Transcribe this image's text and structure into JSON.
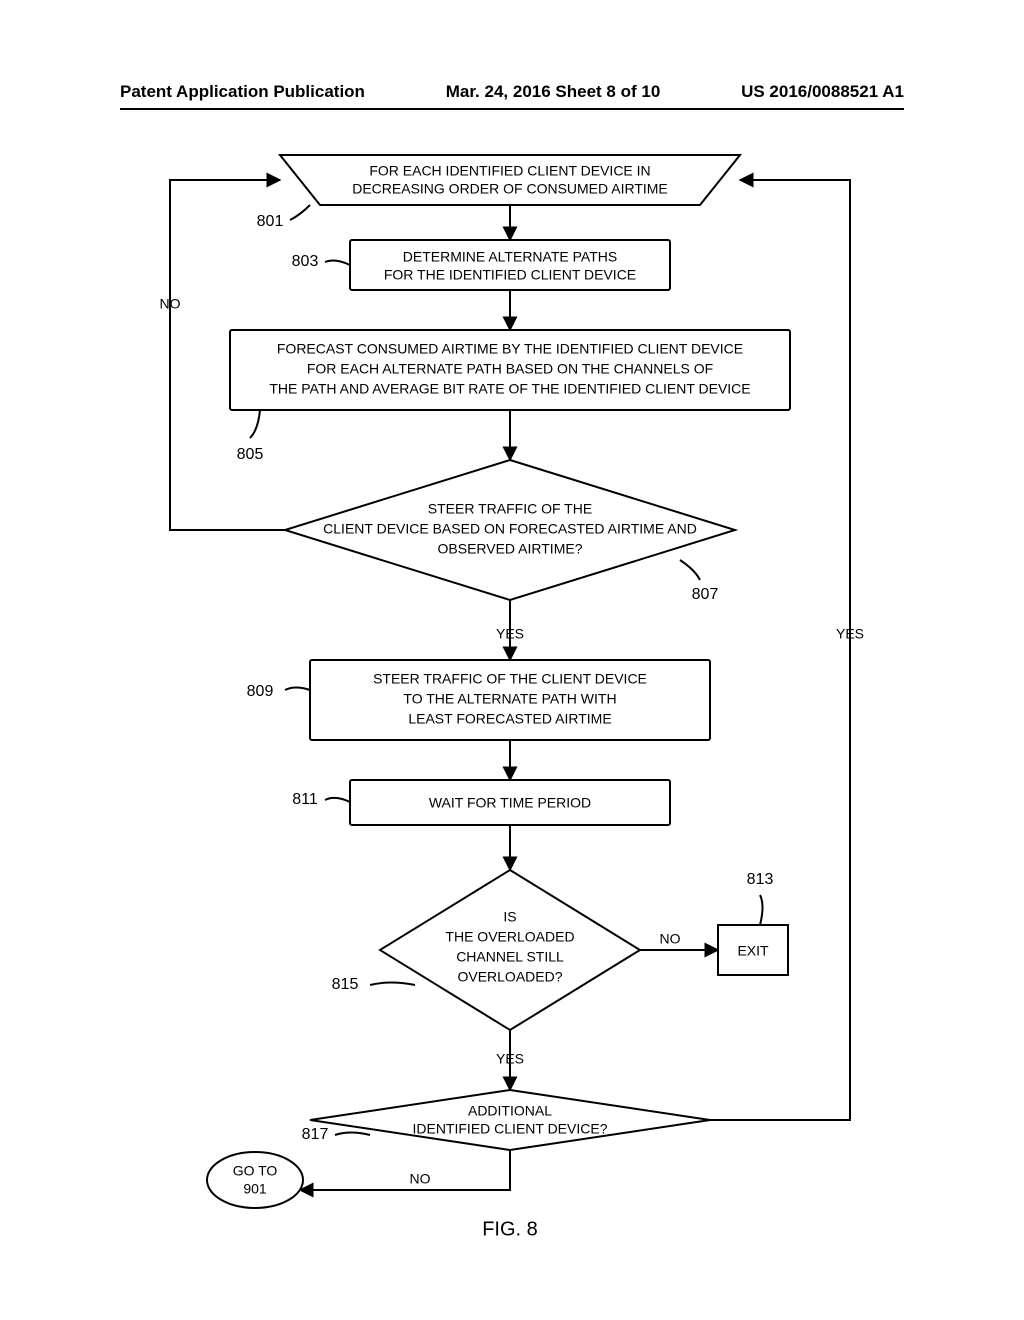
{
  "header": {
    "left": "Patent Application Publication",
    "center": "Mar. 24, 2016  Sheet 8 of 10",
    "right": "US 2016/0088521 A1"
  },
  "figure_label": "FIG. 8",
  "nodes": {
    "n801": {
      "ref": "801",
      "line1": "FOR EACH IDENTIFIED CLIENT DEVICE IN",
      "line2": "DECREASING ORDER OF CONSUMED AIRTIME"
    },
    "n803": {
      "ref": "803",
      "line1": "DETERMINE ALTERNATE PATHS",
      "line2": "FOR THE IDENTIFIED CLIENT DEVICE"
    },
    "n805": {
      "ref": "805",
      "line1": "FORECAST CONSUMED AIRTIME BY THE IDENTIFIED CLIENT DEVICE",
      "line2": "FOR EACH ALTERNATE PATH BASED ON THE CHANNELS OF",
      "line3": "THE PATH AND AVERAGE BIT RATE OF THE IDENTIFIED CLIENT DEVICE"
    },
    "n807": {
      "ref": "807",
      "line1": "STEER TRAFFIC OF THE",
      "line2": "CLIENT DEVICE BASED ON FORECASTED AIRTIME AND",
      "line3": "OBSERVED AIRTIME?"
    },
    "n809": {
      "ref": "809",
      "line1": "STEER TRAFFIC OF THE CLIENT DEVICE",
      "line2": "TO THE ALTERNATE PATH WITH",
      "line3": "LEAST FORECASTED AIRTIME"
    },
    "n811": {
      "ref": "811",
      "text": "WAIT FOR TIME PERIOD"
    },
    "n813": {
      "ref": "813",
      "text": "EXIT"
    },
    "n815": {
      "ref": "815",
      "line1": "IS",
      "line2": "THE OVERLOADED",
      "line3": "CHANNEL STILL",
      "line4": "OVERLOADED?"
    },
    "n817": {
      "ref": "817",
      "line1": "ADDITIONAL",
      "line2": "IDENTIFIED CLIENT DEVICE?"
    },
    "ngoto": {
      "line1": "GO TO",
      "line2": "901"
    }
  },
  "edges": {
    "no": "NO",
    "yes": "YES"
  }
}
